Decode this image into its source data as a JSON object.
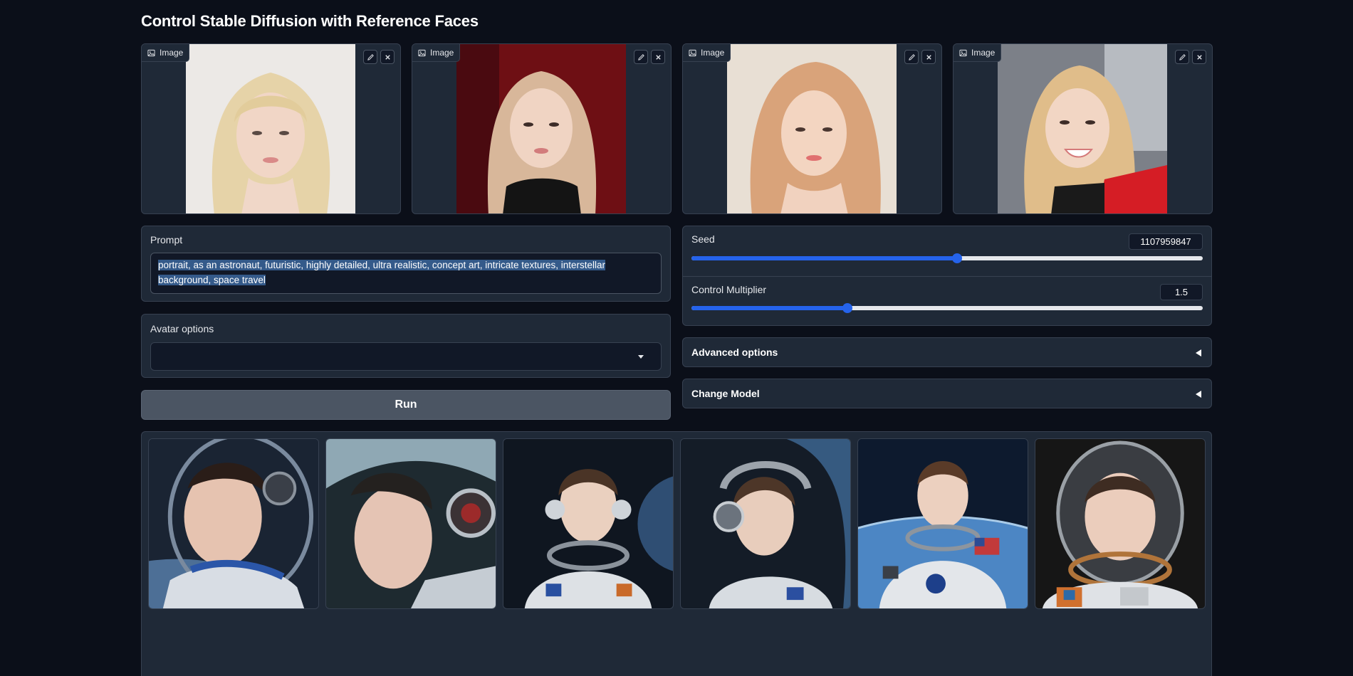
{
  "page": {
    "title": "Control Stable Diffusion with Reference Faces"
  },
  "reference_images": [
    {
      "label": "Image"
    },
    {
      "label": "Image"
    },
    {
      "label": "Image"
    },
    {
      "label": "Image"
    }
  ],
  "prompt": {
    "label": "Prompt",
    "value": "portrait, as an astronaut, futuristic, highly detailed, ultra realistic, concept art, intricate textures, interstellar background, space travel"
  },
  "avatar_options": {
    "label": "Avatar options",
    "value": ""
  },
  "run_button": {
    "label": "Run"
  },
  "seed": {
    "label": "Seed",
    "value": "1107959847",
    "fraction": 0.52
  },
  "control_multiplier": {
    "label": "Control Multiplier",
    "value": "1.5",
    "fraction": 0.305
  },
  "advanced_options": {
    "label": "Advanced options"
  },
  "change_model": {
    "label": "Change Model"
  },
  "gallery": {
    "count": 6
  },
  "colors": {
    "background": "#0b0f19",
    "panel": "#1f2937",
    "accent": "#2563eb",
    "button": "#4b5563"
  }
}
